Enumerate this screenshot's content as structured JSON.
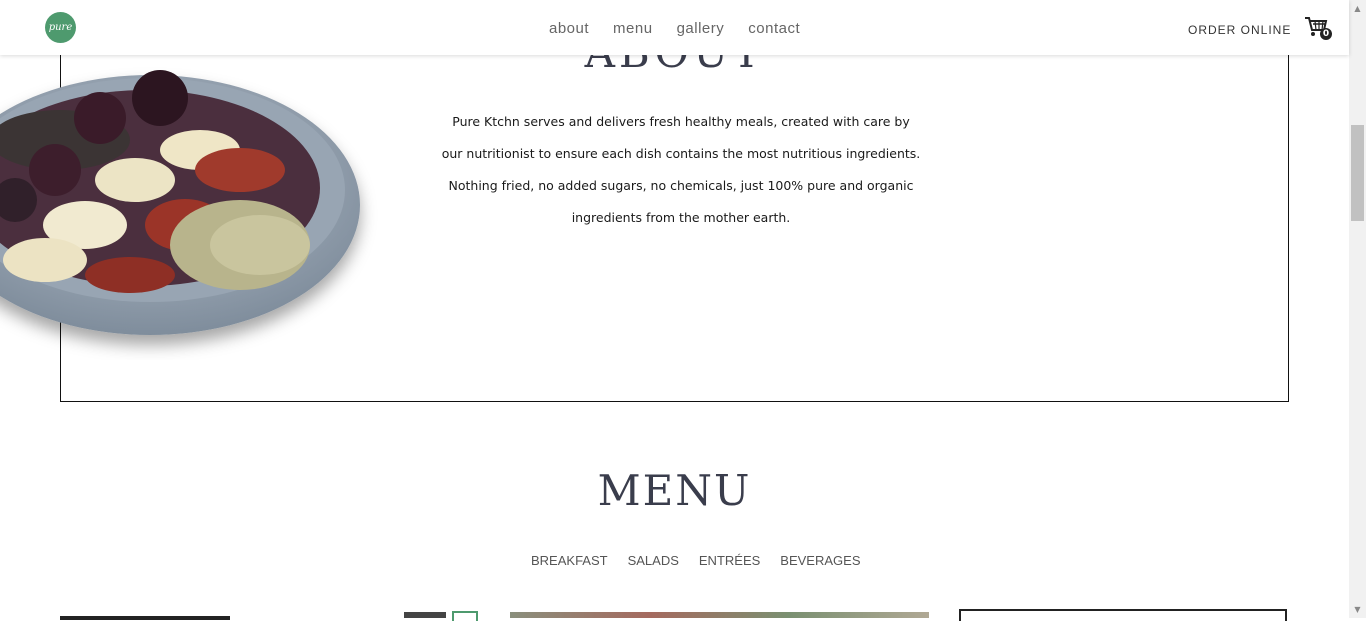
{
  "header": {
    "logo_text": "pure",
    "nav": [
      {
        "label": "about"
      },
      {
        "label": "menu"
      },
      {
        "label": "gallery"
      },
      {
        "label": "contact"
      }
    ],
    "order_online": "ORDER ONLINE",
    "cart_count": "0"
  },
  "about": {
    "title": "ABOUT",
    "text": "Pure Ktchn serves and delivers fresh healthy meals, created with care by our nutritionist to ensure each dish contains the most nutritious ingredients. Nothing fried, no added sugars, no chemicals, just 100% pure and organic ingredients from the mother earth."
  },
  "menu": {
    "title": "MENU",
    "tabs": [
      {
        "label": "BREAKFAST"
      },
      {
        "label": "SALADS"
      },
      {
        "label": "ENTRÉES"
      },
      {
        "label": "BEVERAGES"
      }
    ]
  },
  "colors": {
    "brand_green": "#4e9a6e",
    "heading": "#3a3d4c"
  }
}
